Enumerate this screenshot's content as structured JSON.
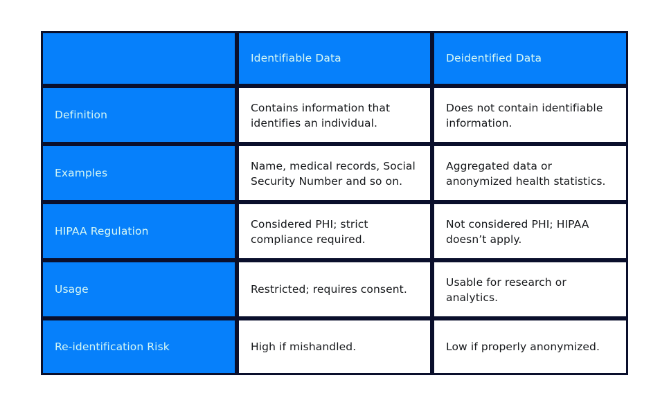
{
  "table": {
    "accent_blue": "#0680fb",
    "border_color": "#0a0f2c",
    "label_text_color": "#d6f7f4",
    "body_text_color": "#15171a",
    "background": "#ffffff",
    "columns": [
      {
        "key": "label",
        "header": ""
      },
      {
        "key": "identifiable",
        "header": "Identifiable Data"
      },
      {
        "key": "deidentified",
        "header": "Deidentified Data"
      }
    ],
    "rows": [
      {
        "label": "Definition",
        "identifiable": "Contains information that identifies an individual.",
        "deidentified": "Does not contain identifiable information."
      },
      {
        "label": "Examples",
        "identifiable": "Name, medical records, Social Security Number and so on.",
        "deidentified": "Aggregated data or anonymized health statistics."
      },
      {
        "label": "HIPAA Regulation",
        "identifiable": "Considered PHI; strict compliance required.",
        "deidentified": "Not considered PHI; HIPAA doesn’t apply."
      },
      {
        "label": "Usage",
        "identifiable": "Restricted; requires consent.",
        "deidentified": "Usable for research or analytics."
      },
      {
        "label": "Re-identification Risk",
        "identifiable": "High if mishandled.",
        "deidentified": "Low if properly anonymized."
      }
    ]
  }
}
